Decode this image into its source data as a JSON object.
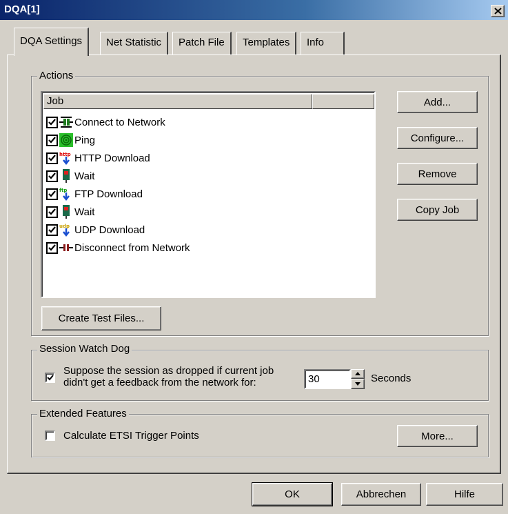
{
  "window": {
    "title": "DQA[1]"
  },
  "tabs": [
    {
      "label": "DQA Settings",
      "active": true
    },
    {
      "label": "Net Statistic",
      "active": false
    },
    {
      "label": "Patch File",
      "active": false
    },
    {
      "label": "Templates",
      "active": false
    },
    {
      "label": "Info",
      "active": false
    }
  ],
  "actions": {
    "group_label": "Actions",
    "list_header": "Job",
    "jobs": [
      {
        "label": "Connect to Network",
        "checked": true,
        "icon": "connect-network-icon"
      },
      {
        "label": "Ping",
        "checked": true,
        "icon": "ping-icon"
      },
      {
        "label": "HTTP Download",
        "checked": true,
        "icon": "http-download-icon"
      },
      {
        "label": "Wait",
        "checked": true,
        "icon": "wait-icon"
      },
      {
        "label": "FTP Download",
        "checked": true,
        "icon": "ftp-download-icon"
      },
      {
        "label": "Wait",
        "checked": true,
        "icon": "wait-icon"
      },
      {
        "label": "UDP Download",
        "checked": true,
        "icon": "udp-download-icon"
      },
      {
        "label": "Disconnect from Network",
        "checked": true,
        "icon": "disconnect-network-icon"
      }
    ],
    "buttons": {
      "add": "Add...",
      "configure": "Configure...",
      "remove": "Remove",
      "copy_job": "Copy Job"
    },
    "create_test_files": "Create Test Files..."
  },
  "watchdog": {
    "group_label": "Session Watch Dog",
    "checked": true,
    "text_line1": "Suppose the session as dropped if current job",
    "text_line2": "didn't get a feedback from the network for:",
    "seconds_value": "30",
    "seconds_label": "Seconds"
  },
  "extended": {
    "group_label": "Extended Features",
    "checked": false,
    "etsi_label": "Calculate ETSI Trigger Points",
    "more_button": "More..."
  },
  "footer": {
    "ok": "OK",
    "cancel": "Abbrechen",
    "help": "Hilfe"
  }
}
